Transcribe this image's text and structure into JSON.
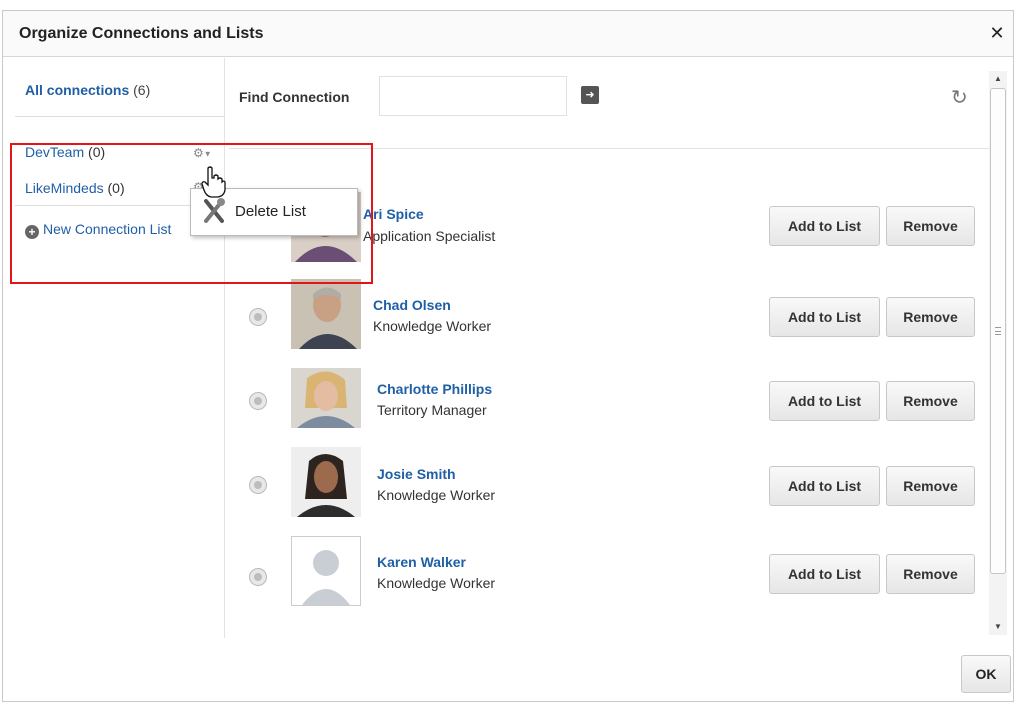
{
  "dialog": {
    "title": "Organize Connections and Lists",
    "close_icon": "close-icon"
  },
  "sidebar": {
    "all_connections": {
      "label": "All connections",
      "count": "(6)"
    },
    "lists": [
      {
        "label": "DevTeam",
        "count": "(0)",
        "icon": "gear-icon"
      },
      {
        "label": "LikeMindeds",
        "count": "(0)",
        "icon": "gear-icon"
      }
    ],
    "new_list": {
      "label": "New Connection List",
      "icon": "plus-circle-icon"
    }
  },
  "context_menu": {
    "items": [
      {
        "label": "Delete List",
        "icon": "tools-icon"
      }
    ]
  },
  "search": {
    "label": "Find Connection",
    "value": "",
    "placeholder": "",
    "go_icon": "arrow-right-icon",
    "refresh_icon": "refresh-icon"
  },
  "connections": [
    {
      "name": "Ari Spice",
      "title": "Application Specialist",
      "add_label": "Add to List",
      "remove_label": "Remove"
    },
    {
      "name": "Chad Olsen",
      "title": "Knowledge Worker",
      "add_label": "Add to List",
      "remove_label": "Remove"
    },
    {
      "name": "Charlotte Phillips",
      "title": "Territory Manager",
      "add_label": "Add to List",
      "remove_label": "Remove"
    },
    {
      "name": "Josie Smith",
      "title": "Knowledge Worker",
      "add_label": "Add to List",
      "remove_label": "Remove"
    },
    {
      "name": "Karen Walker",
      "title": "Knowledge Worker",
      "add_label": "Add to List",
      "remove_label": "Remove"
    }
  ],
  "footer": {
    "ok_label": "OK"
  },
  "colors": {
    "link": "#1f5fa6",
    "highlight": "#e0161b"
  }
}
